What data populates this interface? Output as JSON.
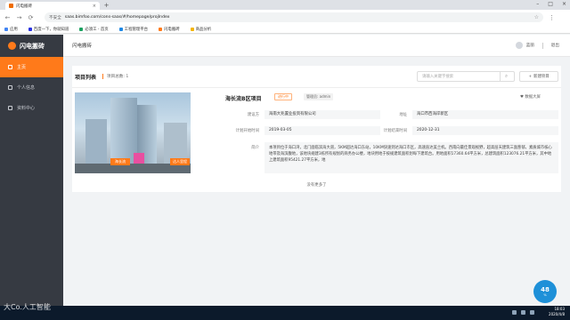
{
  "browser": {
    "tab_title": "闪电搬砖",
    "security": "不安全",
    "url": "saas.bimfoo.com/cons-saas/#/homepage/projIndex",
    "bookmarks": [
      "应用",
      "百度一下，你就知道",
      "必须工 - 首页",
      "工程管理平台",
      "闪电搬砖",
      "商品分析"
    ]
  },
  "app": {
    "logo": "闪电搬砖",
    "crumb": "闪电搬砖",
    "user_name": "蓝丽",
    "user_action": "退出",
    "menu": [
      "主页",
      "个人信息",
      "资料中心"
    ]
  },
  "list": {
    "title": "项目列表",
    "count": "项目总数: 1",
    "search_placeholder": "请输入关键字搜索",
    "new_button": "新建项目",
    "no_more": "没有更多了"
  },
  "project": {
    "name": "海长流B区项目",
    "status": "进行中",
    "manager_label": "管理员: admin",
    "fav": "数据大屏",
    "labels": {
      "builder": "建设方",
      "address": "地址",
      "start": "计划开始时间",
      "end": "计划结束时间",
      "intro": "简介"
    },
    "builder": "海南大兆置业投资有限公司",
    "address": "海口市西海岸新区",
    "start": "2019-03-05",
    "end": "2020-12-31",
    "intro": "本项目位于海口湾，北门面临滨海大道，5KM超达海口东站，10KM快速到达海口市区，高速直达美兰机。西南向最佳景观视野，超高层天建筑三面葱郁，素质城市核心地带及海滨腹地，该地块规建3栋所有规划的商务办公楼，地块用地于按规建筑面积划每下建筑台。用地面积17360.64平方米，总建筑面积123076.21平方米，其中地上建筑面积95421.27平方米，地"
  },
  "thumb_tags": [
    "海长流",
    "达人里程"
  ],
  "taskbar": {
    "time": "18:03",
    "date": "2020/4/8",
    "badge_value": "48",
    "badge_unit": "%"
  },
  "watermark": "大Co.人工智能"
}
